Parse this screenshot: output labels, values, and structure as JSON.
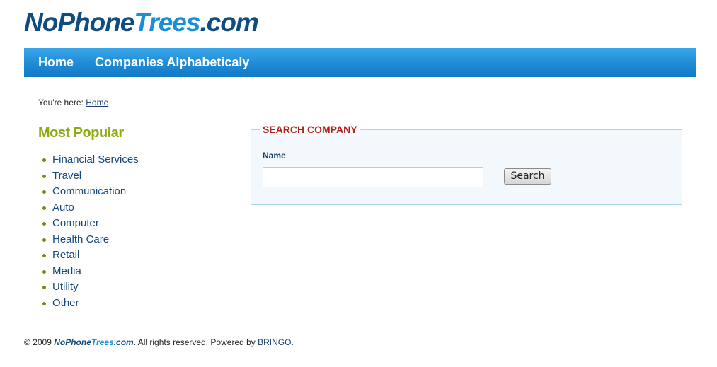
{
  "logo": {
    "part1": "NoPhone",
    "part2": "Trees",
    "part3": ".com"
  },
  "nav": {
    "home": "Home",
    "companies": "Companies Alphabeticaly"
  },
  "breadcrumb": {
    "prefix": "You're here: ",
    "home": "Home"
  },
  "sidebar": {
    "title": "Most Popular",
    "items": [
      {
        "label": "Financial Services"
      },
      {
        "label": "Travel"
      },
      {
        "label": "Communication"
      },
      {
        "label": "Auto"
      },
      {
        "label": "Computer"
      },
      {
        "label": "Health Care"
      },
      {
        "label": "Retail"
      },
      {
        "label": "Media"
      },
      {
        "label": "Utility"
      },
      {
        "label": "Other"
      }
    ]
  },
  "search": {
    "legend": "SEARCH COMPANY",
    "name_label": "Name",
    "input_value": "",
    "button_label": "Search"
  },
  "footer": {
    "copyright": "© 2009 ",
    "brand1": "NoPhone",
    "brand2": "Trees",
    "brand3": ".com",
    "rights": ". All rights reserved. Powered by ",
    "powered_link": "BRINGO",
    "end": "."
  },
  "colors": {
    "brand_dark": "#0f4c80",
    "brand_light": "#1b8fd6",
    "nav_bar": "#1f8bd6",
    "accent_green": "#8aac0f",
    "legend_red": "#b02020"
  }
}
